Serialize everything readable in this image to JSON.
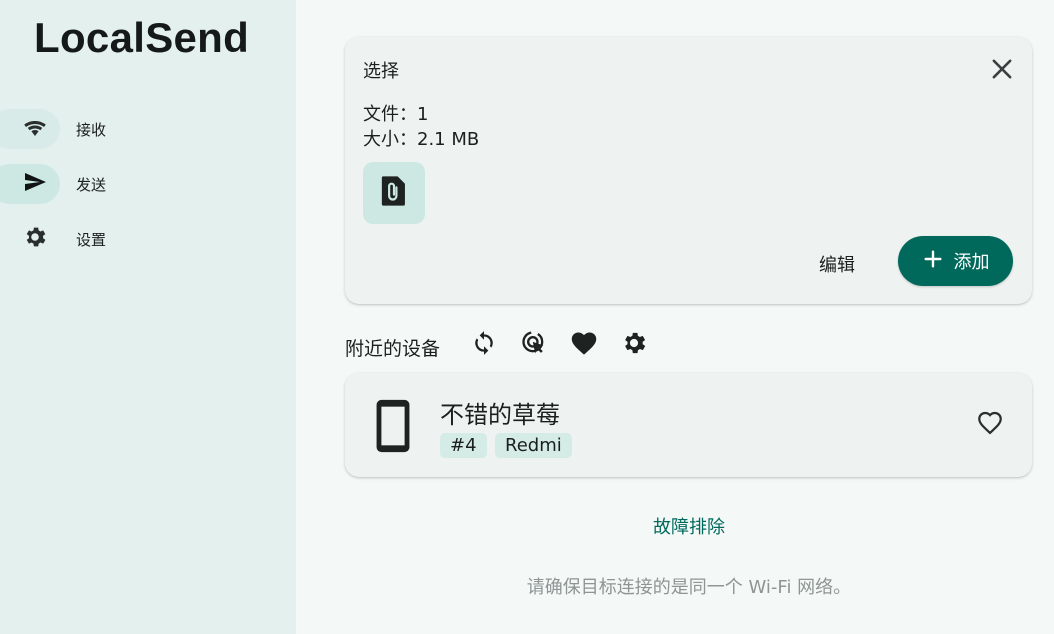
{
  "app": {
    "title": "LocalSend"
  },
  "sidebar": {
    "items": [
      {
        "label": "接收",
        "icon": "wifi-icon"
      },
      {
        "label": "发送",
        "icon": "send-icon"
      },
      {
        "label": "设置",
        "icon": "gear-icon"
      }
    ],
    "active_index": 1
  },
  "selection": {
    "title": "选择",
    "files_line": "文件：1",
    "size_line": "大小：2.1 MB",
    "file_icon": "file-attachment-icon",
    "edit_label": "编辑",
    "add_label": "添加"
  },
  "nearby": {
    "label": "附近的设备",
    "tools": [
      "refresh-icon",
      "scan-target-icon",
      "favorites-icon",
      "settings-icon"
    ]
  },
  "device": {
    "name": "不错的草莓",
    "tags": [
      "#4",
      "Redmi"
    ],
    "icon": "phone-icon"
  },
  "footer": {
    "troubleshoot": "故障排除",
    "hint": "请确保目标连接的是同一个 Wi-Fi 网络。"
  },
  "colors": {
    "accent": "#00695c",
    "sidebar_bg": "#e3f0ee",
    "active_pill": "#cde8e3"
  }
}
